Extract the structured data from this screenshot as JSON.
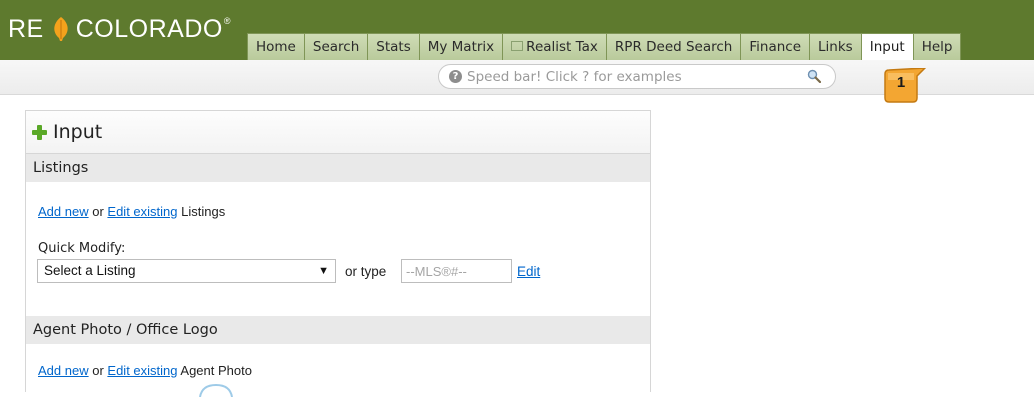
{
  "header": {
    "logo_text_left": "RE",
    "logo_text_right": "COLORADO",
    "logo_mark": "®",
    "tabs": [
      {
        "label": "Home",
        "active": false
      },
      {
        "label": "Search",
        "active": false
      },
      {
        "label": "Stats",
        "active": false
      },
      {
        "label": "My Matrix",
        "active": false
      },
      {
        "label": "Realist Tax",
        "active": false,
        "icon": "external-window-icon"
      },
      {
        "label": "RPR Deed Search",
        "active": false
      },
      {
        "label": "Finance",
        "active": false
      },
      {
        "label": "Links",
        "active": false
      },
      {
        "label": "Input",
        "active": true
      },
      {
        "label": "Help",
        "active": false
      }
    ]
  },
  "speedbar": {
    "placeholder": "Speed bar! Click ? for examples",
    "help_icon": "question-icon",
    "search_icon": "magnifier-icon"
  },
  "callout": {
    "number": "1",
    "color": "#f0a030"
  },
  "panel": {
    "title": "Input",
    "listings": {
      "heading": "Listings",
      "add_new": "Add new",
      "or": "or",
      "edit_existing": "Edit existing",
      "suffix": "Listings",
      "quick_modify_label": "Quick Modify:",
      "select_value": "Select a Listing",
      "or_type": "or type",
      "mls_placeholder": "--MLS®#--",
      "edit": "Edit"
    },
    "agent_photo": {
      "heading": "Agent Photo / Office Logo",
      "add_new": "Add new",
      "or": "or",
      "edit_existing": "Edit existing",
      "suffix": "Agent Photo"
    }
  },
  "colors": {
    "topbar": "#5e7a2e",
    "tab": "#c3d2a6",
    "link": "#0066cc",
    "section": "#e9e9e9"
  }
}
